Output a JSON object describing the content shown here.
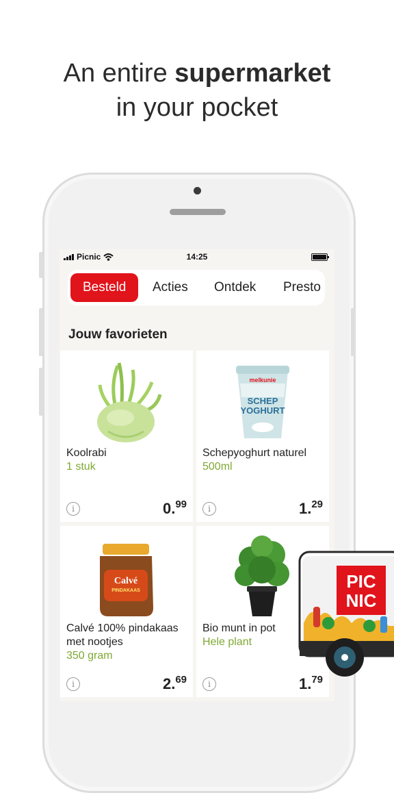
{
  "headline": {
    "line1_prefix": "An entire ",
    "line1_bold": "supermarket",
    "line2": "in your pocket"
  },
  "statusbar": {
    "carrier": "Picnic",
    "time": "14:25"
  },
  "tabs": [
    {
      "label": "Besteld",
      "active": true
    },
    {
      "label": "Acties",
      "active": false
    },
    {
      "label": "Ontdek",
      "active": false
    },
    {
      "label": "Presto",
      "active": false
    }
  ],
  "section_title": "Jouw favorieten",
  "products": [
    {
      "name": "Koolrabi",
      "unit": "1 stuk",
      "price_euros": "0.",
      "price_cents": "99",
      "icon": "kohlrabi-image"
    },
    {
      "name": "Schepyoghurt naturel",
      "unit": "500ml",
      "price_euros": "1.",
      "price_cents": "29",
      "icon": "yoghurt-image",
      "package_text": {
        "brand": "melkunie",
        "line1": "SCHEP",
        "line2": "YOGHURT"
      }
    },
    {
      "name": "Calvé 100% pindakaas met nootjes",
      "unit": "350 gram",
      "price_euros": "2.",
      "price_cents": "69",
      "icon": "peanut-butter-image",
      "label_text": {
        "brand": "Calvé",
        "sub": "PINDAKAAS"
      }
    },
    {
      "name": "Bio munt in pot",
      "unit": "Hele plant",
      "price_euros": "1.",
      "price_cents": "79",
      "icon": "mint-plant-image"
    }
  ],
  "truck": {
    "logo_line1": "PIC",
    "logo_line2": "NIC"
  },
  "colors": {
    "brand_red": "#e1131b",
    "unit_green": "#7fa832"
  }
}
